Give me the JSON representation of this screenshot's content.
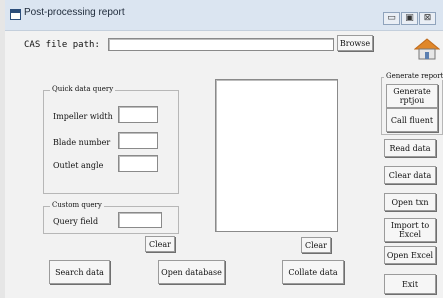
{
  "window": {
    "title": "Post-processing report",
    "controls": [
      "▭",
      "▣",
      "⊠"
    ]
  },
  "top": {
    "cas_label": "CAS file path:",
    "browse_label": "Browse",
    "cas_value": "",
    "home_icon": "home-icon"
  },
  "quick_query": {
    "title": "Quick data query",
    "fields": [
      {
        "label": "Impeller width",
        "value": ""
      },
      {
        "label": "Blade number",
        "value": ""
      },
      {
        "label": "Outlet angle",
        "value": ""
      }
    ]
  },
  "custom_query": {
    "title": "Custom query",
    "field_label": "Query field",
    "value": ""
  },
  "buttons": {
    "clear_left": "Clear",
    "clear_right": "Clear",
    "search": "Search data",
    "open_db": "Open database",
    "collate": "Collate data"
  },
  "right_panel": {
    "generate_title": "Generate report",
    "generate_btn": "Generate rptjou",
    "call_btn": "Call fluent",
    "read": "Read data",
    "clear": "Clear data",
    "open_txn": "Open txn",
    "import_excel": "Import to Excel",
    "open_excel": "Open Excel",
    "exit": "Exit"
  }
}
